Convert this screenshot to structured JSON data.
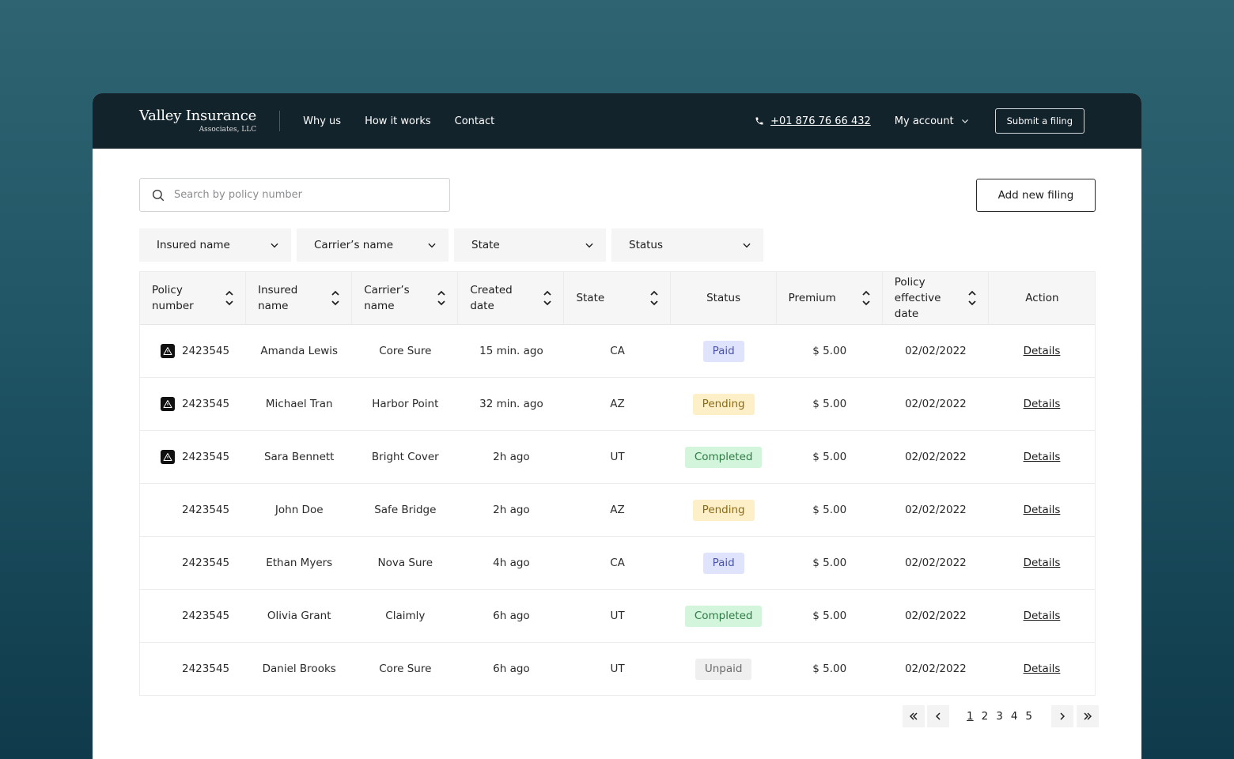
{
  "brand": {
    "name": "Valley Insurance",
    "sub": "Associates, LLC"
  },
  "nav": {
    "links": [
      "Why us",
      "How it works",
      "Contact"
    ],
    "phone": "+01 876 76 66 432",
    "account": "My account",
    "submit": "Submit a filing"
  },
  "search": {
    "placeholder": "Search by policy number"
  },
  "add_button": "Add new filing",
  "filters": [
    "Insured name",
    "Carrier’s name",
    "State",
    "Status"
  ],
  "columns": [
    "Policy\nnumber",
    "Insured\nname",
    "Carrier’s\nname",
    "Created\ndate",
    "State",
    "Status",
    "Premium",
    "Policy\neffective date",
    "Action"
  ],
  "rows": [
    {
      "warning": true,
      "policy": "2423545",
      "insured": "Amanda Lewis",
      "carrier": "Core Sure",
      "created": "15 min. ago",
      "state": "CA",
      "status": "Paid",
      "status_type": "paid",
      "premium": "$ 5.00",
      "effective": "02/02/2022",
      "action": "Details"
    },
    {
      "warning": true,
      "policy": "2423545",
      "insured": "Michael Tran",
      "carrier": "Harbor Point",
      "created": "32 min. ago",
      "state": "AZ",
      "status": "Pending",
      "status_type": "pending",
      "premium": "$ 5.00",
      "effective": "02/02/2022",
      "action": "Details"
    },
    {
      "warning": true,
      "policy": "2423545",
      "insured": "Sara Bennett",
      "carrier": "Bright Cover",
      "created": "2h ago",
      "state": "UT",
      "status": "Completed",
      "status_type": "completed",
      "premium": "$ 5.00",
      "effective": "02/02/2022",
      "action": "Details"
    },
    {
      "warning": false,
      "policy": "2423545",
      "insured": "John Doe",
      "carrier": "Safe Bridge",
      "created": "2h ago",
      "state": "AZ",
      "status": "Pending",
      "status_type": "pending",
      "premium": "$ 5.00",
      "effective": "02/02/2022",
      "action": "Details"
    },
    {
      "warning": false,
      "policy": "2423545",
      "insured": "Ethan Myers",
      "carrier": "Nova Sure",
      "created": "4h ago",
      "state": "CA",
      "status": "Paid",
      "status_type": "paid",
      "premium": "$ 5.00",
      "effective": "02/02/2022",
      "action": "Details"
    },
    {
      "warning": false,
      "policy": "2423545",
      "insured": "Olivia Grant",
      "carrier": "Claimly",
      "created": "6h ago",
      "state": "UT",
      "status": "Completed",
      "status_type": "completed",
      "premium": "$ 5.00",
      "effective": "02/02/2022",
      "action": "Details"
    },
    {
      "warning": false,
      "policy": "2423545",
      "insured": "Daniel Brooks",
      "carrier": "Core Sure",
      "created": "6h ago",
      "state": "UT",
      "status": "Unpaid",
      "status_type": "unpaid",
      "premium": "$ 5.00",
      "effective": "02/02/2022",
      "action": "Details"
    }
  ],
  "pagination": {
    "pages": [
      "1",
      "2",
      "3",
      "4",
      "5"
    ],
    "current": "1"
  }
}
